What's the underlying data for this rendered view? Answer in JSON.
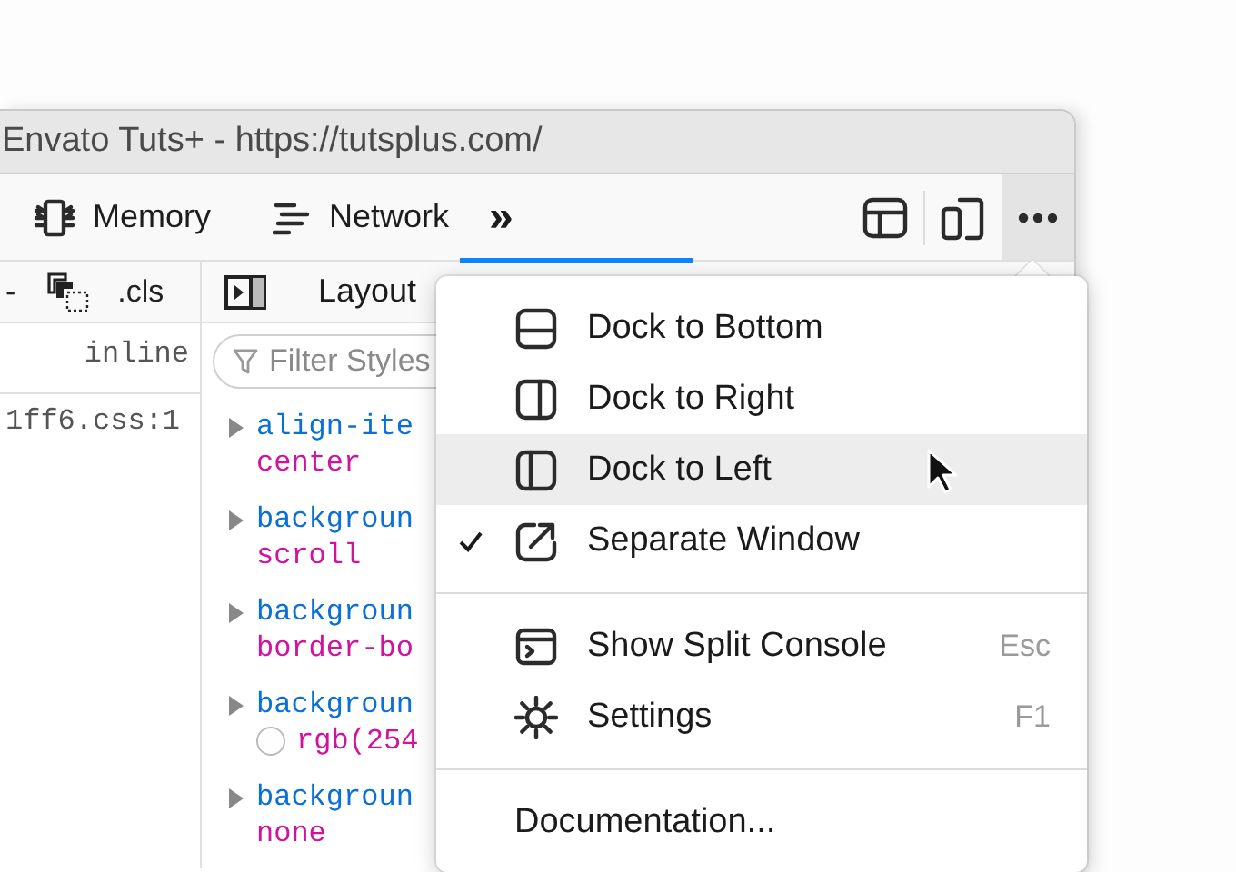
{
  "window": {
    "title": "Envato Tuts+ - https://tutsplus.com/"
  },
  "toolbar": {
    "tabs": [
      {
        "label": "Memory"
      },
      {
        "label": "Network"
      }
    ],
    "overflow": "»",
    "options_button": {
      "selected": true
    }
  },
  "left_pane": {
    "tool_text": "-",
    "cls": ".cls",
    "display": "inline",
    "source": "1ff6.css:1"
  },
  "right_pane": {
    "tabs": [
      {
        "label": "Layout",
        "selected": false
      }
    ],
    "filter": {
      "placeholder": "Filter Styles"
    },
    "properties": [
      {
        "name": "align-ite",
        "value": "center",
        "kind": "plain"
      },
      {
        "name": "backgroun",
        "value": "scroll",
        "kind": "plain"
      },
      {
        "name": "backgroun",
        "value": "border-bo",
        "kind": "plain"
      },
      {
        "name": "backgroun",
        "value": "rgb(254",
        "kind": "color"
      },
      {
        "name": "backgroun",
        "value": "none",
        "kind": "plain"
      }
    ]
  },
  "menu": {
    "items": [
      {
        "kind": "item",
        "label": "Dock to Bottom",
        "checked": false,
        "hovered": false
      },
      {
        "kind": "item",
        "label": "Dock to Right",
        "checked": false,
        "hovered": false
      },
      {
        "kind": "item",
        "label": "Dock to Left",
        "checked": false,
        "hovered": true
      },
      {
        "kind": "item",
        "label": "Separate Window",
        "checked": true,
        "hovered": false
      },
      {
        "kind": "separator"
      },
      {
        "kind": "item",
        "label": "Show Split Console",
        "shortcut": "Esc",
        "checked": false,
        "hovered": false
      },
      {
        "kind": "item",
        "label": "Settings",
        "shortcut": "F1",
        "checked": false,
        "hovered": false
      },
      {
        "kind": "separator"
      },
      {
        "kind": "item",
        "label": "Documentation...",
        "checked": false,
        "hovered": false
      }
    ]
  }
}
